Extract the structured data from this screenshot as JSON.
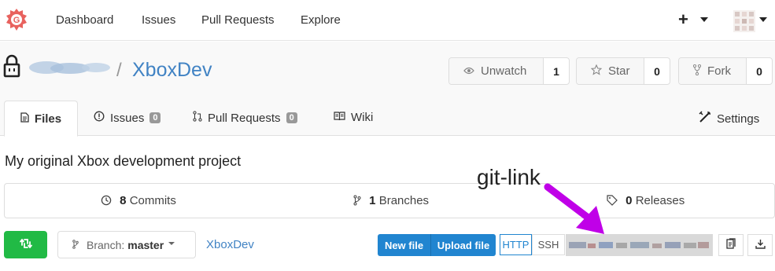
{
  "nav": {
    "items": [
      "Dashboard",
      "Issues",
      "Pull Requests",
      "Explore"
    ],
    "plus": "+"
  },
  "repo": {
    "name": "XboxDev",
    "slash": "/",
    "watch": {
      "label": "Unwatch",
      "count": "1"
    },
    "star": {
      "label": "Star",
      "count": "0"
    },
    "fork": {
      "label": "Fork",
      "count": "0"
    }
  },
  "tabs": {
    "files": "Files",
    "issues": {
      "label": "Issues",
      "count": "0"
    },
    "pulls": {
      "label": "Pull Requests",
      "count": "0"
    },
    "wiki": "Wiki",
    "settings": "Settings"
  },
  "description": "My original Xbox development project",
  "annotation": "git-link",
  "stats": {
    "commits": {
      "count": "8",
      "label": "Commits"
    },
    "branches": {
      "count": "1",
      "label": "Branches"
    },
    "releases": {
      "count": "0",
      "label": "Releases"
    }
  },
  "toolbar": {
    "branch_prefix": "Branch:",
    "branch_name": "master",
    "breadcrumb": "XboxDev",
    "new_file": "New file",
    "upload_file": "Upload file",
    "http": "HTTP",
    "ssh": "SSH"
  },
  "colors": {
    "accent": "#4183c4",
    "primary_button": "#2185d0",
    "sync_button": "#21ba45",
    "annotation_arrow": "#c000e8"
  },
  "icons": [
    "gitea-logo",
    "lock-icon",
    "eye-icon",
    "star-icon",
    "fork-icon",
    "file-icon",
    "issue-icon",
    "pull-request-icon",
    "book-icon",
    "tools-icon",
    "history-icon",
    "branch-icon",
    "tag-icon",
    "sync-icon",
    "copy-icon",
    "download-icon"
  ]
}
